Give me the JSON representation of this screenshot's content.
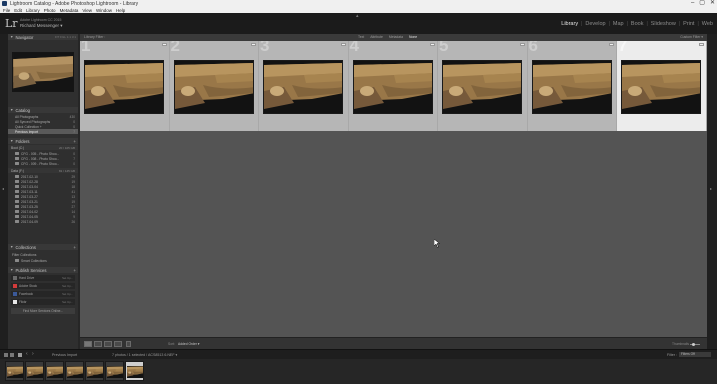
{
  "window": {
    "title": "Lightroom Catalog - Adobe Photoshop Lightroom - Library",
    "controls": [
      "–",
      "▢",
      "✕"
    ]
  },
  "menu": [
    "File",
    "Edit",
    "Library",
    "Photo",
    "Metadata",
    "View",
    "Window",
    "Help"
  ],
  "identity": {
    "logo": "Lr",
    "catalog": "Adobe Lightroom CC 2015",
    "user": "Richard Messenger ▾"
  },
  "modules": [
    {
      "label": "Library",
      "active": true
    },
    {
      "label": "Develop",
      "active": false
    },
    {
      "label": "Map",
      "active": false
    },
    {
      "label": "Book",
      "active": false
    },
    {
      "label": "Slideshow",
      "active": false
    },
    {
      "label": "Print",
      "active": false
    },
    {
      "label": "Web",
      "active": false
    }
  ],
  "left_panel": {
    "navigator": {
      "label": "Navigator",
      "extra": "FIT  FILL  1:1  3:1"
    },
    "catalog": {
      "label": "Catalog",
      "items": [
        {
          "label": "All Photographs",
          "count": "430"
        },
        {
          "label": "All Synced Photographs",
          "count": "0"
        },
        {
          "label": "Quick Collection +",
          "count": "0"
        },
        {
          "label": "Previous Import",
          "count": "7",
          "selected": true
        }
      ]
    },
    "folders": {
      "label": "Folders",
      "drives": [
        {
          "label": "Boot (C:)",
          "space": "20 / 105 GB",
          "items": [
            {
              "label": "CFG - 005 - Photo Shoo...",
              "count": "0"
            },
            {
              "label": "CFG - 008 - Photo Shoo...",
              "count": "7"
            },
            {
              "label": "CFG - 009 - Photo Shoo...",
              "count": "0"
            }
          ]
        },
        {
          "label": "Data (F:)",
          "space": "81 / 145 GB",
          "items": [
            {
              "label": "2017-02-10",
              "count": "29"
            },
            {
              "label": "2017-02-28",
              "count": "19"
            },
            {
              "label": "2017-03-04",
              "count": "18"
            },
            {
              "label": "2017-03-11",
              "count": "41"
            },
            {
              "label": "2017-03-27",
              "count": "13"
            },
            {
              "label": "2017-03-21",
              "count": "19"
            },
            {
              "label": "2017-03-25",
              "count": "27"
            },
            {
              "label": "2017-04-02",
              "count": "14"
            },
            {
              "label": "2017-04-05",
              "count": "9"
            },
            {
              "label": "2017-04-09",
              "count": "26"
            }
          ]
        }
      ]
    },
    "collections": {
      "label": "Collections",
      "items": [
        {
          "label": "Filter Collections"
        },
        {
          "label": "Smart Collections"
        }
      ]
    },
    "publish": {
      "label": "Publish Services",
      "items": [
        {
          "label": "Hard Drive",
          "action": "Set Up...",
          "color": "#6b6b6b"
        },
        {
          "label": "Adobe Stock",
          "action": "Set Up...",
          "color": "#d23b3b"
        },
        {
          "label": "Facebook",
          "action": "Set Up...",
          "color": "#3b5998"
        },
        {
          "label": "Flickr",
          "action": "Set Up...",
          "color": "#e8e8e8"
        }
      ],
      "find_more": "Find More Services Online..."
    },
    "buttons": {
      "import": "Import...",
      "export": "Export..."
    }
  },
  "filter_bar": {
    "left": "Library Filter :",
    "options": [
      {
        "label": "Text",
        "on": false
      },
      {
        "label": "Attribute",
        "on": false
      },
      {
        "label": "Metadata",
        "on": false
      },
      {
        "label": "None",
        "on": true
      }
    ],
    "right": "Custom Filter ▾"
  },
  "grid": {
    "cells": [
      {
        "index": "1",
        "selected": false
      },
      {
        "index": "2",
        "selected": false
      },
      {
        "index": "3",
        "selected": false
      },
      {
        "index": "4",
        "selected": false
      },
      {
        "index": "5",
        "selected": false
      },
      {
        "index": "6",
        "selected": false
      },
      {
        "index": "7",
        "selected": true
      }
    ]
  },
  "toolbar": {
    "sort_label": "Sort:",
    "sort_value": "Added Order ▾",
    "thumbnails_label": "Thumbnails"
  },
  "filmstrip_bar": {
    "source": "Previous Import",
    "count": "7 photos / 1 selected / ACS8513 6.NEF ▾",
    "filter_label": "Filter :",
    "filter_value": "Filters Off"
  },
  "filmstrip": {
    "count": 7,
    "selected_index": 6
  },
  "colors": {
    "accent": "#e6e6e6",
    "panel": "#2f2f2f",
    "grid_bg": "#545454",
    "cell": "#b6b6b6",
    "cell_selected": "#ececec"
  }
}
